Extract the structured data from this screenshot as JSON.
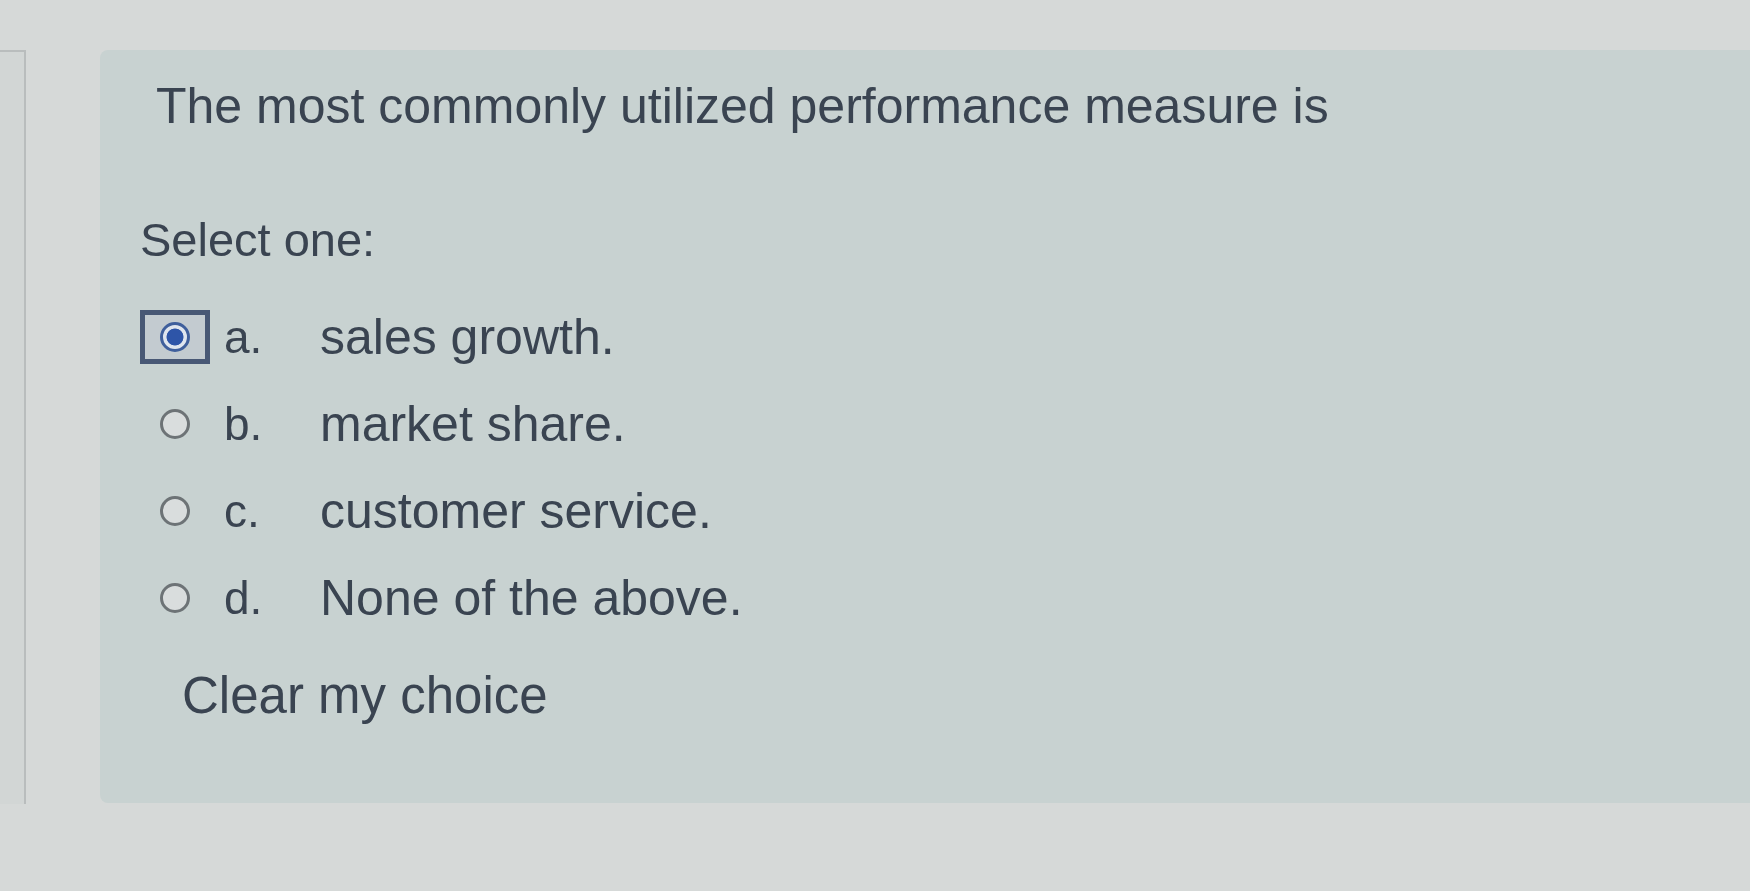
{
  "question": {
    "text": "The most commonly utilized performance measure is"
  },
  "prompt": "Select one:",
  "options": [
    {
      "letter": "a.",
      "text": "sales growth.",
      "selected": true,
      "focused": true
    },
    {
      "letter": "b.",
      "text": "market share.",
      "selected": false,
      "focused": false
    },
    {
      "letter": "c.",
      "text": "customer service.",
      "selected": false,
      "focused": false
    },
    {
      "letter": "d.",
      "text": "None of the above.",
      "selected": false,
      "focused": false
    }
  ],
  "clear_link": "Clear my choice"
}
